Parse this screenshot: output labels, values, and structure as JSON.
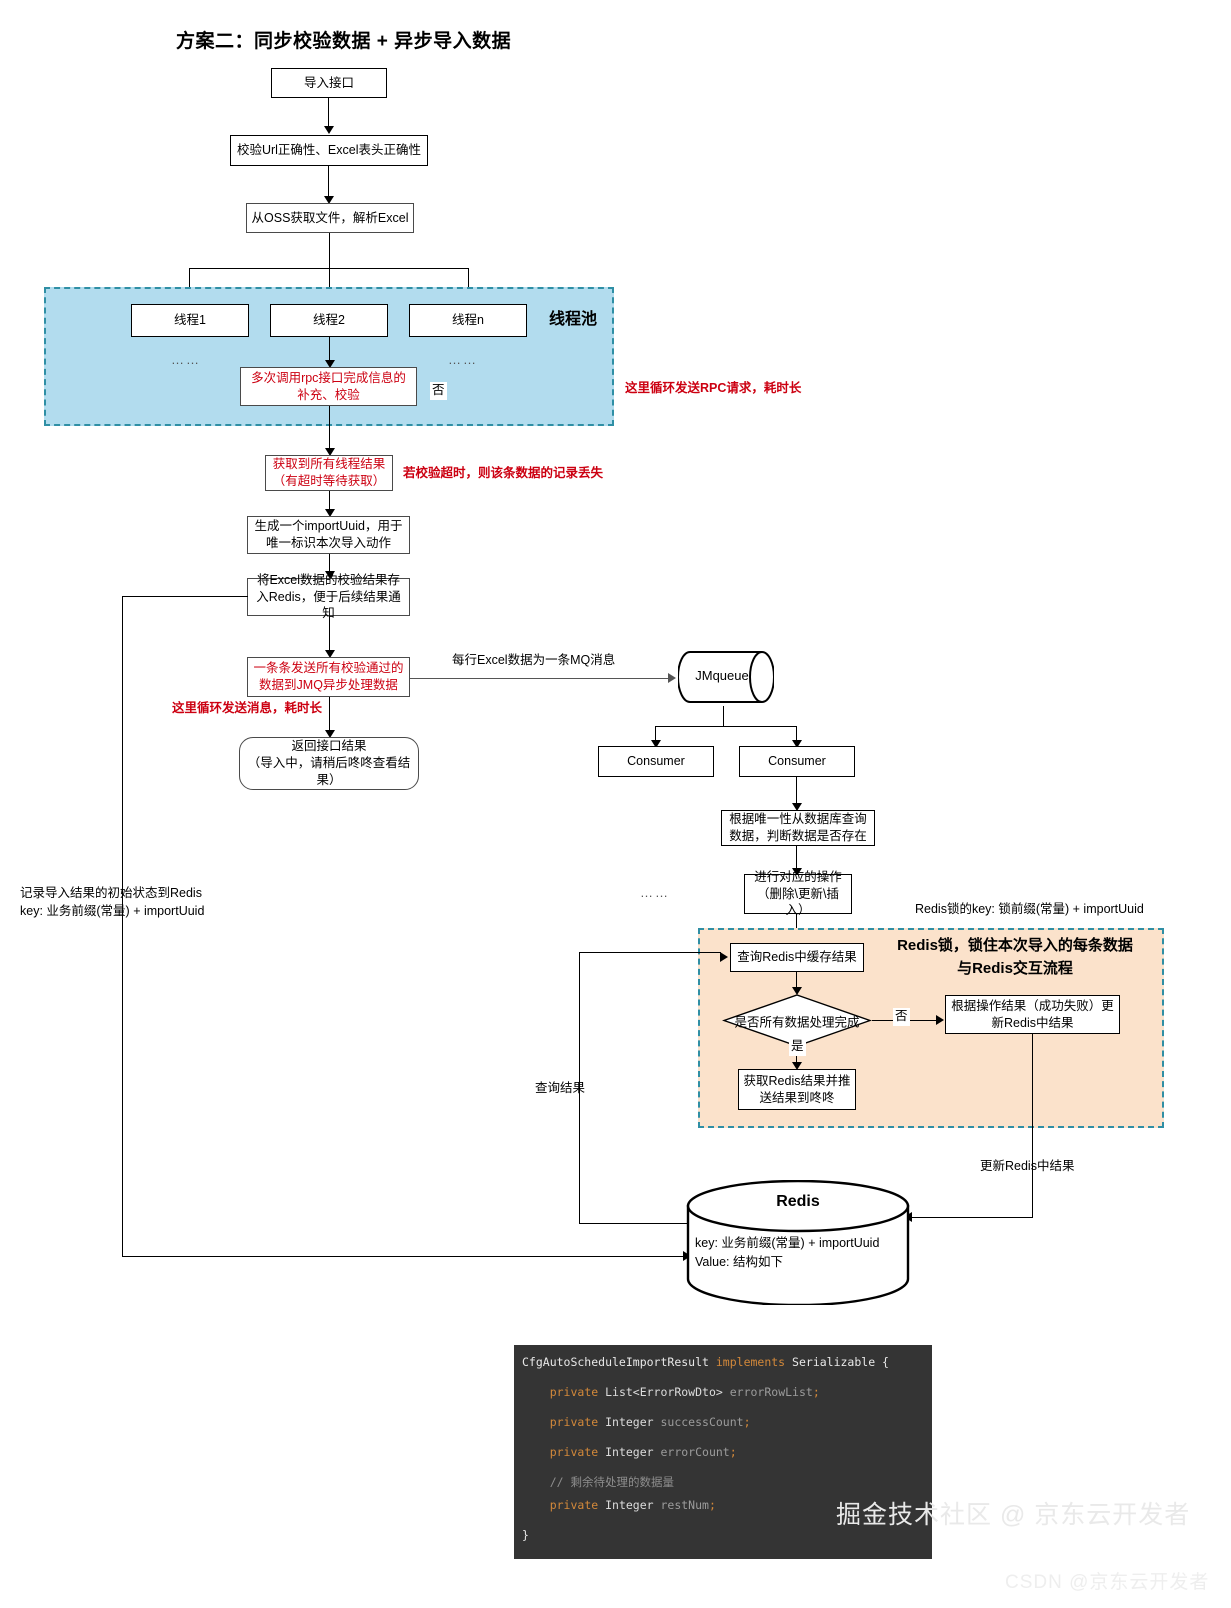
{
  "title": "方案二：同步校验数据 + 异步导入数据",
  "nodes": {
    "import_api": "导入接口",
    "validate_url": "校验Url正确性、Excel表头正确性",
    "fetch_oss": "从OSS获取文件，解析Excel",
    "thread1": "线程1",
    "thread2": "线程2",
    "threadn": "线程n",
    "rpc_call": "多次调用rpc接口完成信息的补充、校验",
    "get_all_thread_result": "获取到所有线程结果\n（有超时等待获取）",
    "gen_uuid": "生成一个importUuid，用于唯一标识本次导入动作",
    "save_redis": "将Excel数据的校验结果存入Redis，便于后续结果通知",
    "send_jmq": "一条条发送所有校验通过的数据到JMQ异步处理数据",
    "return_result": "返回接口结果\n（导入中，请稍后咚咚查看结果）",
    "jmqueue": "JMqueue",
    "consumer_left": "Consumer",
    "consumer_right": "Consumer",
    "query_db": "根据唯一性从数据库查询数据，判断数据是否存在",
    "do_operation": "进行对应的操作\n（删除\\更新\\插入）",
    "query_redis_cache": "查询Redis中缓存结果",
    "decision_all_done": "是否所有数据处理完成",
    "update_redis_result": "根据操作结果（成功失败）更新Redis中结果",
    "push_result": "获取Redis结果并推送结果到咚咚",
    "redis_title": "Redis",
    "redis_body": "key: 业务前缀(常量) + importUuid\nValue: 结构如下"
  },
  "labels": {
    "thread_pool": "线程池",
    "rpc_note": "这里循环发送RPC请求，耗时长",
    "timeout_note": "若校验超时，则该条数据的记录丢失",
    "no_1": "否",
    "mq_note": "每行Excel数据为一条MQ消息",
    "loop_send_note": "这里循环发送消息，耗时长",
    "record_init_note": "记录导入结果的初始状态到Redis\nkey: 业务前缀(常量) + importUuid",
    "redis_lock_key": "Redis锁的key: 锁前缀(常量) + importUuid",
    "redis_lock_region": "Redis锁，锁住本次导入的每条数据\n与Redis交互流程",
    "decision_no": "否",
    "decision_yes": "是",
    "query_result": "查询结果",
    "update_redis_result_edge": "更新Redis中结果",
    "dots_1": "……",
    "dots_2": "……",
    "dots_3": "……"
  },
  "code": {
    "lines": [
      [
        {
          "t": "CfgAutoScheduleImportResult ",
          "c": "pl"
        },
        {
          "t": "implements",
          "c": "kw"
        },
        {
          "t": " Serializable {",
          "c": "pl"
        }
      ],
      [],
      [
        {
          "t": "    ",
          "c": "pl"
        },
        {
          "t": "private",
          "c": "kw"
        },
        {
          "t": " List<ErrorRowDto> ",
          "c": "ty"
        },
        {
          "t": "errorRowList",
          "c": "id"
        },
        {
          "t": ";",
          "c": "kw"
        }
      ],
      [],
      [
        {
          "t": "    ",
          "c": "pl"
        },
        {
          "t": "private",
          "c": "kw"
        },
        {
          "t": " Integer ",
          "c": "ty"
        },
        {
          "t": "successCount",
          "c": "id"
        },
        {
          "t": ";",
          "c": "kw"
        }
      ],
      [],
      [
        {
          "t": "    ",
          "c": "pl"
        },
        {
          "t": "private",
          "c": "kw"
        },
        {
          "t": " Integer ",
          "c": "ty"
        },
        {
          "t": "errorCount",
          "c": "id"
        },
        {
          "t": ";",
          "c": "kw"
        }
      ],
      [],
      [
        {
          "t": "    // 剩余待处理的数据量",
          "c": "cm"
        }
      ],
      [
        {
          "t": "    ",
          "c": "pl"
        },
        {
          "t": "private",
          "c": "kw"
        },
        {
          "t": " Integer ",
          "c": "ty"
        },
        {
          "t": "restNum",
          "c": "id"
        },
        {
          "t": ";",
          "c": "kw"
        }
      ],
      [],
      [
        {
          "t": "}",
          "c": "pl"
        }
      ]
    ]
  },
  "watermark": {
    "line1": "掘金技术社区 @ 京东云开发者",
    "line2": "CSDN @京东云开发者"
  },
  "colors": {
    "thread_pool_fill": "#b2dcee",
    "redis_lock_fill": "#fbe2cb",
    "region_border": "#2f8fa5",
    "annotation_red": "#cc0011",
    "code_bg": "#343434"
  }
}
